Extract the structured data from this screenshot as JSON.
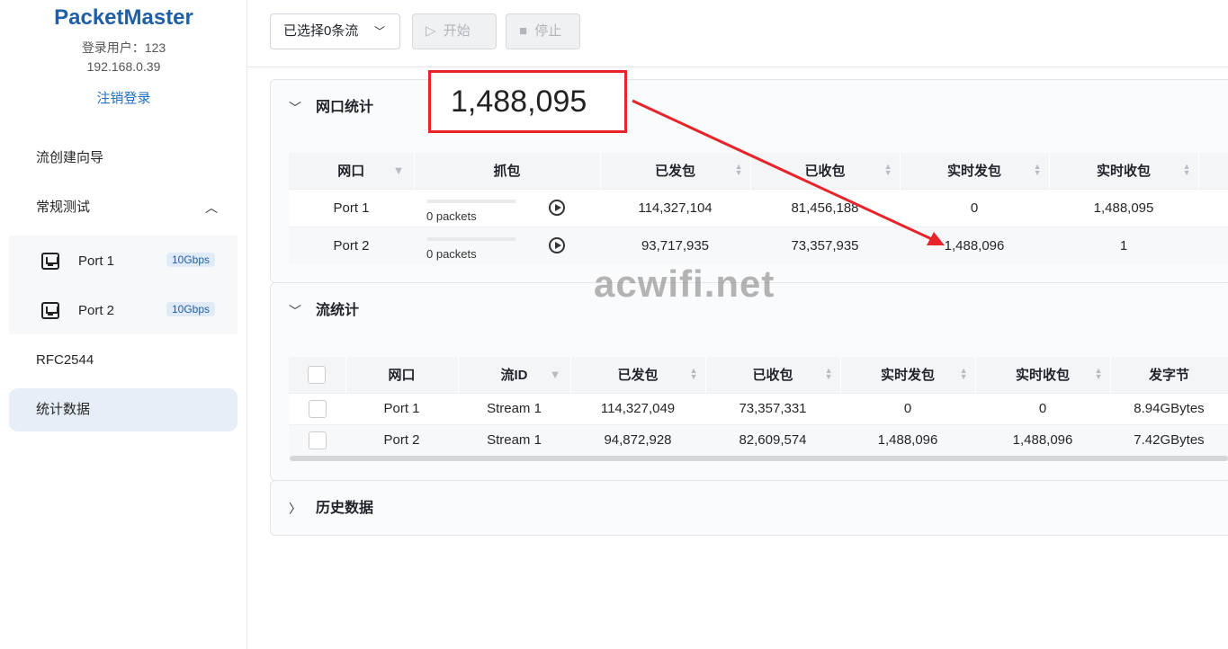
{
  "sidebar": {
    "brand": "PacketMaster",
    "user": "登录用户：123",
    "ip": "192.168.0.39",
    "logout": "注销登录",
    "nav": {
      "wizard": "流创建向导",
      "routine": "常规测试",
      "rfc": "RFC2544",
      "stats": "统计数据"
    },
    "ports": [
      {
        "name": "Port 1",
        "speed": "10Gbps"
      },
      {
        "name": "Port 2",
        "speed": "10Gbps"
      }
    ]
  },
  "toolbar": {
    "select_label": "已选择0条流",
    "start_label": "开始",
    "stop_label": "停止"
  },
  "port_stats": {
    "title": "网口统计",
    "headers": [
      "网口",
      "抓包",
      "已发包",
      "已收包",
      "实时发包",
      "实时收包"
    ],
    "rows": [
      {
        "port": "Port 1",
        "capture": "0 packets",
        "sent": "114,327,104",
        "recv": "81,456,188",
        "rt_sent": "0",
        "rt_recv": "1,488,095"
      },
      {
        "port": "Port 2",
        "capture": "0 packets",
        "sent": "93,717,935",
        "recv": "73,357,935",
        "rt_sent": "1,488,096",
        "rt_recv": "1"
      }
    ]
  },
  "stream_stats": {
    "title": "流统计",
    "headers": [
      "网口",
      "流ID",
      "已发包",
      "已收包",
      "实时发包",
      "实时收包",
      "发字节"
    ],
    "rows": [
      {
        "port": "Port 1",
        "stream": "Stream 1",
        "sent": "114,327,049",
        "recv": "73,357,331",
        "rt_sent": "0",
        "rt_recv": "0",
        "bytes": "8.94GBytes"
      },
      {
        "port": "Port 2",
        "stream": "Stream 1",
        "sent": "94,872,928",
        "recv": "82,609,574",
        "rt_sent": "1,488,096",
        "rt_recv": "1,488,096",
        "bytes": "7.42GBytes"
      }
    ]
  },
  "history": {
    "title": "历史数据"
  },
  "annotation": {
    "highlight_value": "1,488,095",
    "watermark": "acwifi.net",
    "color": "#e8232a"
  }
}
